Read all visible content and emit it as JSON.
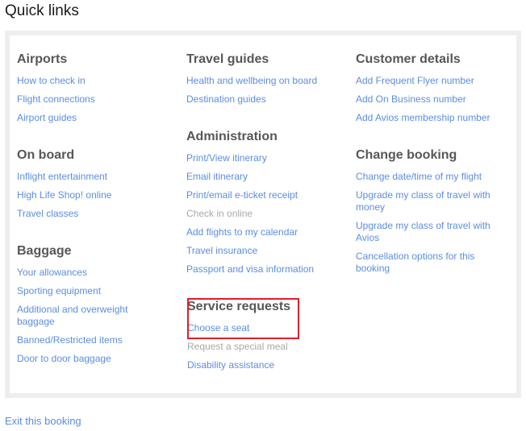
{
  "page": {
    "title": "Quick links"
  },
  "colors": {
    "link": "#5b8de0",
    "disabled": "#a8a8a8",
    "heading": "#575757",
    "highlight": "#e11d2b",
    "panel_border": "#eeeeee"
  },
  "columns": [
    {
      "sections": [
        {
          "title": "Airports",
          "items": [
            {
              "label": "How to check in",
              "disabled": false
            },
            {
              "label": "Flight connections",
              "disabled": false
            },
            {
              "label": "Airport guides",
              "disabled": false
            }
          ]
        },
        {
          "title": "On board",
          "items": [
            {
              "label": "Inflight entertainment",
              "disabled": false
            },
            {
              "label": "High Life Shop! online",
              "disabled": false
            },
            {
              "label": "Travel classes",
              "disabled": false
            }
          ]
        },
        {
          "title": "Baggage",
          "items": [
            {
              "label": "Your allowances",
              "disabled": false
            },
            {
              "label": "Sporting equipment",
              "disabled": false
            },
            {
              "label": "Additional and overweight baggage",
              "disabled": false
            },
            {
              "label": "Banned/Restricted items",
              "disabled": false
            },
            {
              "label": "Door to door baggage",
              "disabled": false
            }
          ]
        }
      ]
    },
    {
      "sections": [
        {
          "title": "Travel guides",
          "items": [
            {
              "label": "Health and wellbeing on board",
              "disabled": false
            },
            {
              "label": "Destination guides",
              "disabled": false
            }
          ]
        },
        {
          "title": "Administration",
          "items": [
            {
              "label": "Print/View itinerary",
              "disabled": false
            },
            {
              "label": "Email itinerary",
              "disabled": false
            },
            {
              "label": "Print/email e-ticket receipt",
              "disabled": false
            },
            {
              "label": "Check in online",
              "disabled": true
            },
            {
              "label": "Add flights to my calendar",
              "disabled": false
            },
            {
              "label": "Travel insurance",
              "disabled": false
            },
            {
              "label": "Passport and visa information",
              "disabled": false
            }
          ]
        },
        {
          "title": "Service requests",
          "items": [
            {
              "label": "Choose a seat",
              "disabled": false
            },
            {
              "label": "Request a special meal",
              "disabled": true
            },
            {
              "label": "Disability assistance",
              "disabled": false
            }
          ]
        }
      ]
    },
    {
      "sections": [
        {
          "title": "Customer details",
          "items": [
            {
              "label": "Add Frequent Flyer number",
              "disabled": false
            },
            {
              "label": "Add On Business number",
              "disabled": false
            },
            {
              "label": "Add Avios membership number",
              "disabled": false
            }
          ]
        },
        {
          "title": "Change booking",
          "items": [
            {
              "label": "Change date/time of my flight",
              "disabled": false
            },
            {
              "label": "Upgrade my class of travel with money",
              "disabled": false
            },
            {
              "label": "Upgrade my class of travel with Avios",
              "disabled": false
            },
            {
              "label": "Cancellation options for this booking",
              "disabled": false
            }
          ]
        }
      ]
    }
  ],
  "footer": {
    "exit_label": "Exit this booking"
  }
}
